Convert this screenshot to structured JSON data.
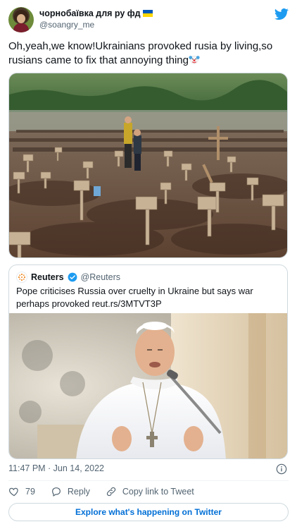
{
  "user": {
    "display_name": "чорнобаївка для ру фд",
    "handle": "@soangry_me"
  },
  "tweet": {
    "text": "Oh,yeah,we know!Ukrainians provoked rusia by living,so rusians came to fix that annoying thing",
    "emoji": "clown-face-icon"
  },
  "quoted": {
    "name": "Reuters",
    "handle": "@Reuters",
    "text": "Pope criticises Russia over cruelty in Ukraine but says war perhaps provoked reut.rs/3MTVT3P"
  },
  "meta": {
    "timestamp": "11:47 PM · Jun 14, 2022"
  },
  "actions": {
    "likes": "79",
    "reply_label": "Reply",
    "copy_label": "Copy link to Tweet"
  },
  "explore_label": "Explore what's happening on Twitter",
  "colors": {
    "twitter_blue": "#1d9bf0",
    "link": "#006fd6",
    "secondary_text": "#536471",
    "border": "#cfd9de",
    "flag_blue": "#0057b7",
    "flag_yellow": "#ffd700"
  }
}
